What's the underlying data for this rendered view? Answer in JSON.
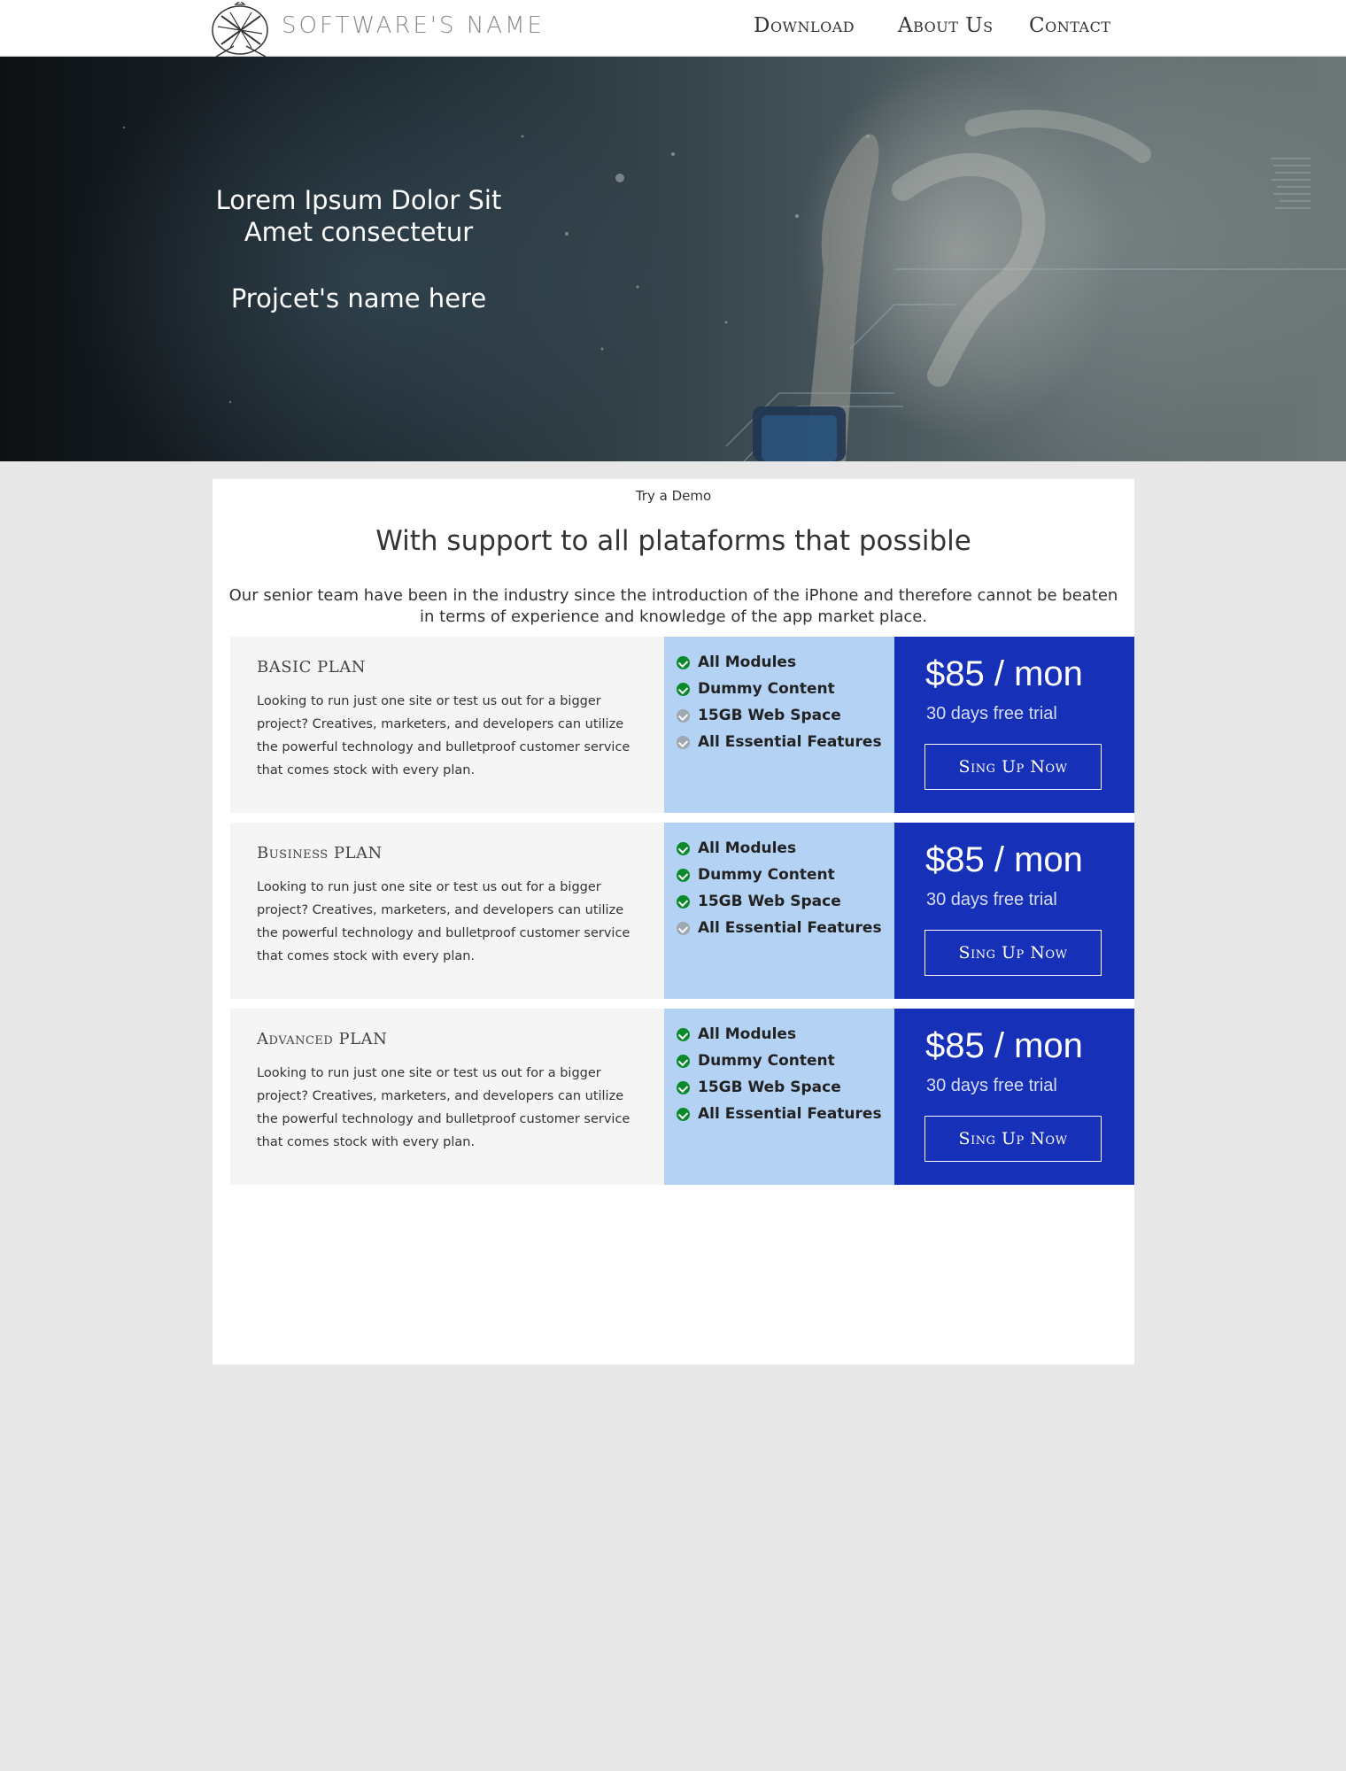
{
  "header": {
    "brand": "SOFTWARE'S NAME",
    "logo_icon": "crossed-arrows-badge-icon",
    "nav": [
      "Download",
      "About Us",
      "Contact"
    ]
  },
  "hero": {
    "title_line1": "Lorem Ipsum Dolor Sit",
    "title_line2": "Amet consectetur",
    "project": "Projcet's name here"
  },
  "main": {
    "try_demo": "Try a Demo",
    "title": "With support to all plataforms that possible",
    "description": "Our senior team have been in the industry since the introduction of the iPhone and therefore cannot be beaten in terms of experience and knowledge of the app market place."
  },
  "plans": [
    {
      "name": "BASIC PLAN",
      "description": "Looking to run just one site or test us out for a bigger project? Creatives, marketers, and developers can utilize the powerful technology and bulletproof customer service that comes stock with every plan.",
      "features": [
        {
          "label": "All Modules",
          "included": true
        },
        {
          "label": "Dummy Content",
          "included": true
        },
        {
          "label": "15GB Web Space",
          "included": false
        },
        {
          "label": "All Essential Features",
          "included": false
        }
      ],
      "price": "$85 / mon",
      "trial": "30 days free trial",
      "cta": "Sing Up Now"
    },
    {
      "name": "Business PLAN",
      "description": "Looking to run just one site or test us out for a bigger project? Creatives, marketers, and developers can utilize the powerful technology and bulletproof customer service that comes stock with every plan.",
      "features": [
        {
          "label": "All Modules",
          "included": true
        },
        {
          "label": "Dummy Content",
          "included": true
        },
        {
          "label": "15GB Web Space",
          "included": true
        },
        {
          "label": "All Essential Features",
          "included": false
        }
      ],
      "price": "$85 / mon",
      "trial": "30 days free trial",
      "cta": "Sing Up Now"
    },
    {
      "name": "Advanced PLAN",
      "description": "Looking to run just one site or test us out for a bigger project? Creatives, marketers, and developers can utilize the powerful technology and bulletproof customer service that comes stock with every plan.",
      "features": [
        {
          "label": "All Modules",
          "included": true
        },
        {
          "label": "Dummy Content",
          "included": true
        },
        {
          "label": "15GB Web Space",
          "included": true
        },
        {
          "label": "All Essential Features",
          "included": true
        }
      ],
      "price": "$85 / mon",
      "trial": "30 days free trial",
      "cta": "Sing Up Now"
    }
  ],
  "colors": {
    "price_panel": "#1730b8",
    "features_panel": "#b4d2f4",
    "check_included": "#0a8a2a",
    "check_excluded": "#9ea6ae",
    "page_background": "#e7e7e7"
  }
}
